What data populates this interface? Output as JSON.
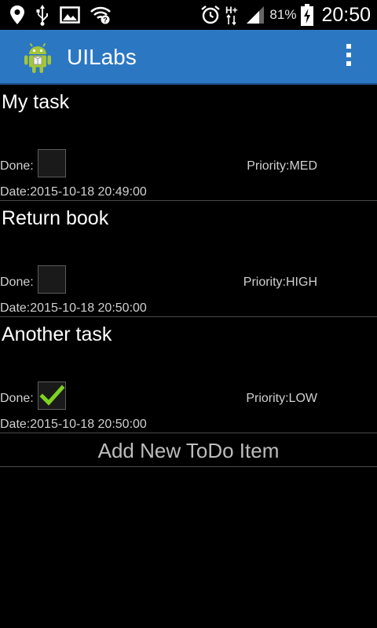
{
  "status_bar": {
    "battery_percent": "81%",
    "time": "20:50",
    "network": "H+",
    "icons": [
      "location-icon",
      "usb-icon",
      "image-icon",
      "wifi-icon",
      "alarm-icon",
      "signal-icon",
      "battery-charging-icon"
    ]
  },
  "action_bar": {
    "title": "UILabs",
    "color": "#2c77c2"
  },
  "todos": [
    {
      "title": "My task",
      "done_label": "Done:",
      "done": false,
      "priority": "Priority:MED",
      "date": "Date:2015-10-18 20:49:00"
    },
    {
      "title": "Return book",
      "done_label": "Done:",
      "done": false,
      "priority": "Priority:HIGH",
      "date": "Date:2015-10-18 20:50:00"
    },
    {
      "title": "Another task",
      "done_label": "Done:",
      "done": true,
      "priority": "Priority:LOW",
      "date": "Date:2015-10-18 20:50:00"
    }
  ],
  "footer": {
    "add_label": "Add New ToDo Item"
  }
}
